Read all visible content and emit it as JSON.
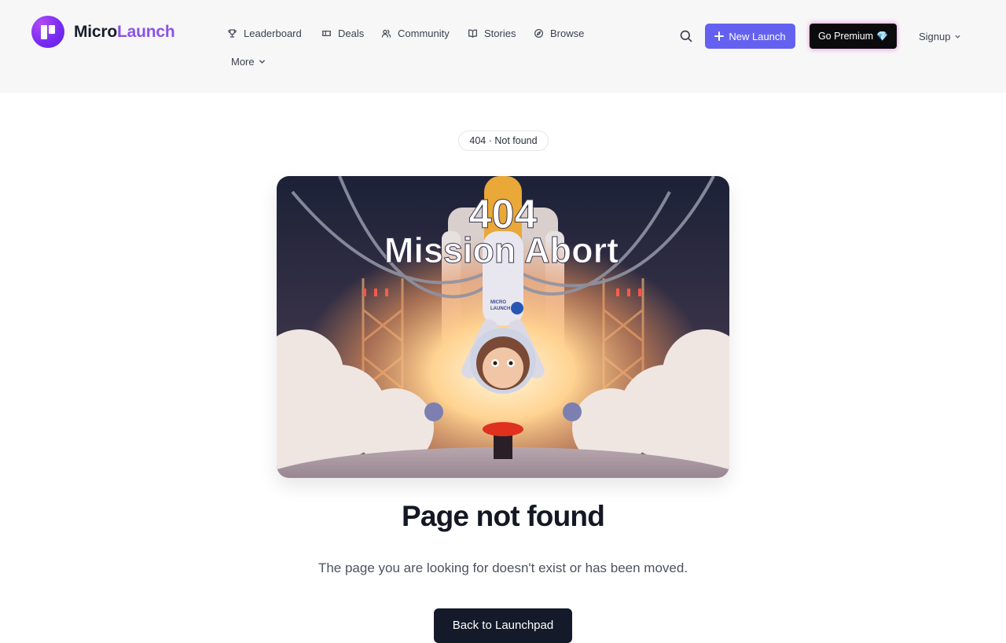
{
  "brand": {
    "name_part1": "Micro",
    "name_part2": "Launch",
    "accent_color": "#8a52e8"
  },
  "nav": {
    "items": [
      {
        "label": "Leaderboard",
        "icon": "trophy-icon"
      },
      {
        "label": "Deals",
        "icon": "ticket-icon"
      },
      {
        "label": "Community",
        "icon": "users-icon"
      },
      {
        "label": "Stories",
        "icon": "book-icon"
      },
      {
        "label": "Browse",
        "icon": "compass-icon"
      }
    ],
    "more_label": "More"
  },
  "header_actions": {
    "search_icon": "search-icon",
    "new_launch_label": "New Launch",
    "new_launch_color": "#6561f0",
    "premium_label": "Go Premium",
    "premium_gem": "💎",
    "signup_label": "Signup"
  },
  "main": {
    "badge": "404 · Not found",
    "hero_image": {
      "title_line1": "404",
      "title_line2": "Mission Abort",
      "suit_text1": "MICRO",
      "suit_text2": "LAUNCH"
    },
    "title": "Page not found",
    "message": "The page you are looking for doesn't exist or has been moved.",
    "back_button_label": "Back to Launchpad"
  }
}
